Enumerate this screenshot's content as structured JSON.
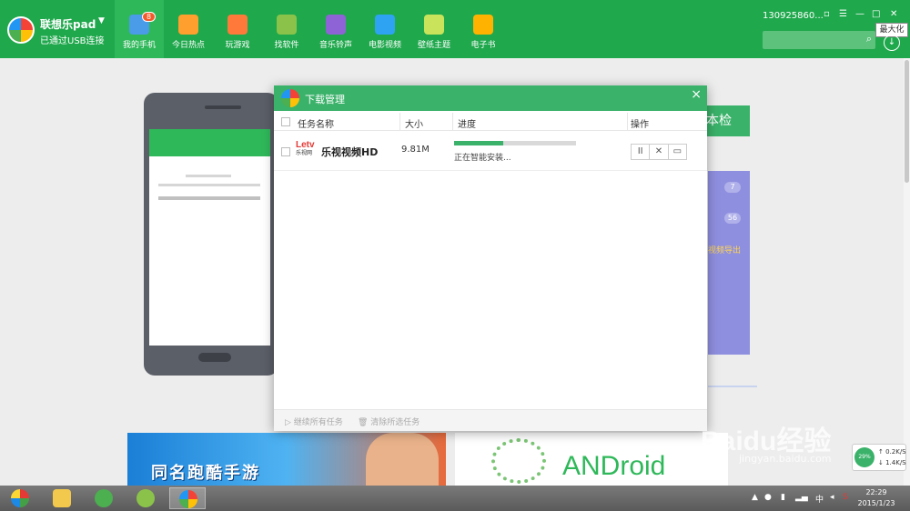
{
  "app": {
    "name": "联想乐pad",
    "caret": "▼",
    "connection": "已通过USB连接"
  },
  "nav": [
    {
      "label": "我的手机",
      "badge": "8",
      "color": "#4a9be8",
      "active": true
    },
    {
      "label": "今日热点",
      "color": "#ff9f2e"
    },
    {
      "label": "玩游戏",
      "color": "#ff7a3a"
    },
    {
      "label": "找软件",
      "color": "#8bc34a"
    },
    {
      "label": "音乐铃声",
      "color": "#8e63d6"
    },
    {
      "label": "电影视频",
      "color": "#2ea3f2"
    },
    {
      "label": "壁纸主题",
      "color": "#c9e35a"
    },
    {
      "label": "电子书",
      "color": "#ffb300"
    }
  ],
  "account": {
    "number": "130925860..."
  },
  "window_controls": {
    "minimize": "—",
    "maximize": "□",
    "tooltip": "最大化"
  },
  "search": {
    "placeholder": ""
  },
  "background": {
    "check_button": "本检",
    "count1": "7",
    "count2": "56",
    "export_link": "视频导出"
  },
  "dialog": {
    "title": "下载管理",
    "close": "×",
    "columns": {
      "name": "任务名称",
      "size": "大小",
      "progress": "进度",
      "action": "操作"
    },
    "tasks": [
      {
        "name": "乐视视频HD",
        "size": "9.81M",
        "progress": 0.4,
        "status": "正在智能安装..."
      }
    ],
    "ops": {
      "pause": "II",
      "cancel": "✕",
      "folder": "▭"
    },
    "footer": {
      "resume_all": "继续所有任务",
      "clear_selected": "清除所选任务"
    }
  },
  "banners": {
    "game_text": "同名跑酷手游",
    "android_text": "ANDroid"
  },
  "network": {
    "percent": "29%",
    "up": "0.2K/S",
    "down": "1.4K/S"
  },
  "taskbar": {
    "ime": "中",
    "time": "22:29",
    "date": "2015/1/23"
  },
  "watermark": {
    "brand": "Baidu经验",
    "url": "jingyan.baidu.com"
  }
}
